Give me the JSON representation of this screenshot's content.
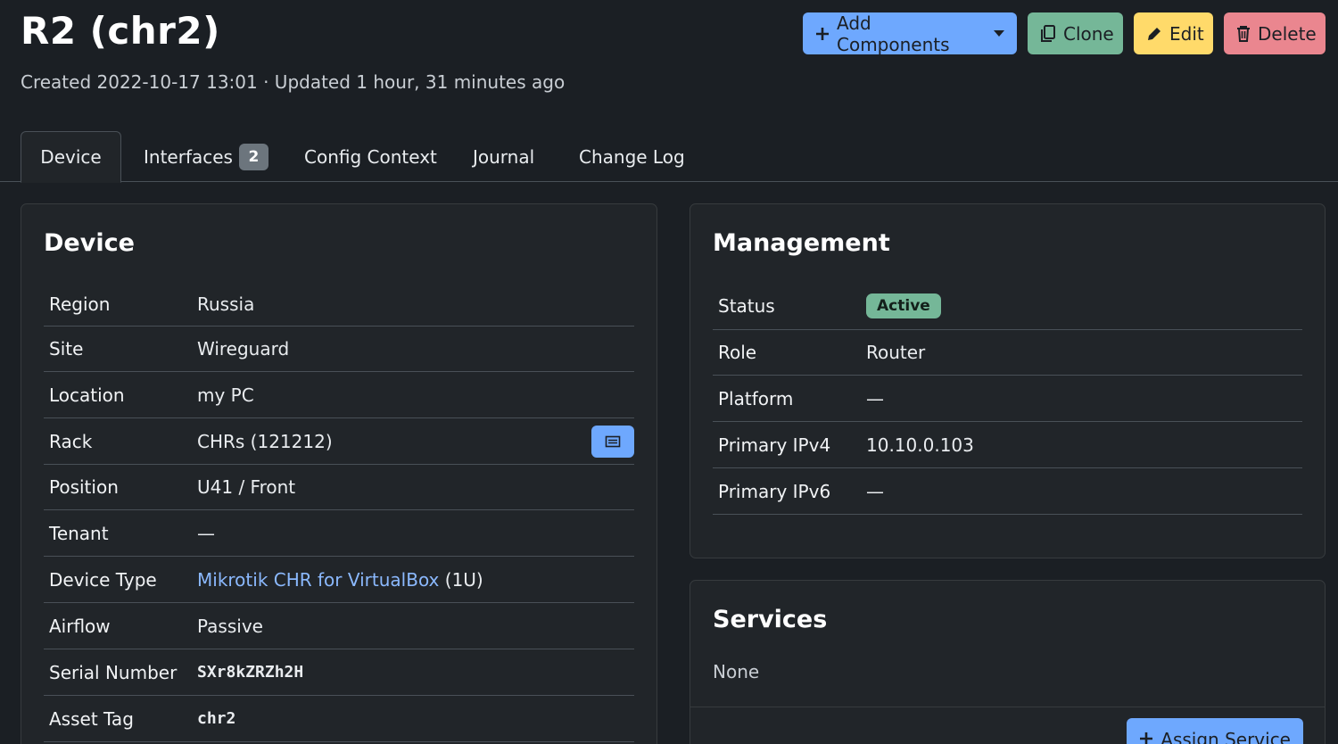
{
  "header": {
    "title": "R2 (chr2)",
    "subtitle": "Created 2022-10-17 13:01 · Updated 1 hour, 31 minutes ago"
  },
  "actions": {
    "add_components": "Add Components",
    "clone": "Clone",
    "edit": "Edit",
    "delete": "Delete"
  },
  "tabs": [
    {
      "label": "Device"
    },
    {
      "label": "Interfaces",
      "count": "2"
    },
    {
      "label": "Config Context"
    },
    {
      "label": "Journal"
    },
    {
      "label": "Change Log"
    }
  ],
  "device": {
    "title": "Device",
    "rows": [
      {
        "label": "Region",
        "value": "Russia"
      },
      {
        "label": "Site",
        "value": "Wireguard"
      },
      {
        "label": "Location",
        "value": "my PC"
      },
      {
        "label": "Rack",
        "value": "CHRs (121212)"
      },
      {
        "label": "Position",
        "value": "U41 / Front"
      },
      {
        "label": "Tenant",
        "value": "—"
      },
      {
        "label": "Device Type",
        "value": "Mikrotik CHR for VirtualBox",
        "suffix": "(1U)"
      },
      {
        "label": "Airflow",
        "value": "Passive"
      },
      {
        "label": "Serial Number",
        "value": "SXr8kZRZh2H"
      },
      {
        "label": "Asset Tag",
        "value": "chr2"
      }
    ]
  },
  "management": {
    "title": "Management",
    "rows": [
      {
        "label": "Status",
        "value": "Active"
      },
      {
        "label": "Role",
        "value": "Router"
      },
      {
        "label": "Platform",
        "value": "—"
      },
      {
        "label": "Primary IPv4",
        "value": "10.10.0.103"
      },
      {
        "label": "Primary IPv6",
        "value": "—"
      }
    ]
  },
  "services": {
    "title": "Services",
    "none": "None",
    "assign": "Assign Service"
  },
  "colors": {
    "primary": "#6ea8fe",
    "success": "#75b798",
    "warning": "#ffda6a",
    "danger": "#ea868f",
    "link": "#8bb9fe"
  }
}
